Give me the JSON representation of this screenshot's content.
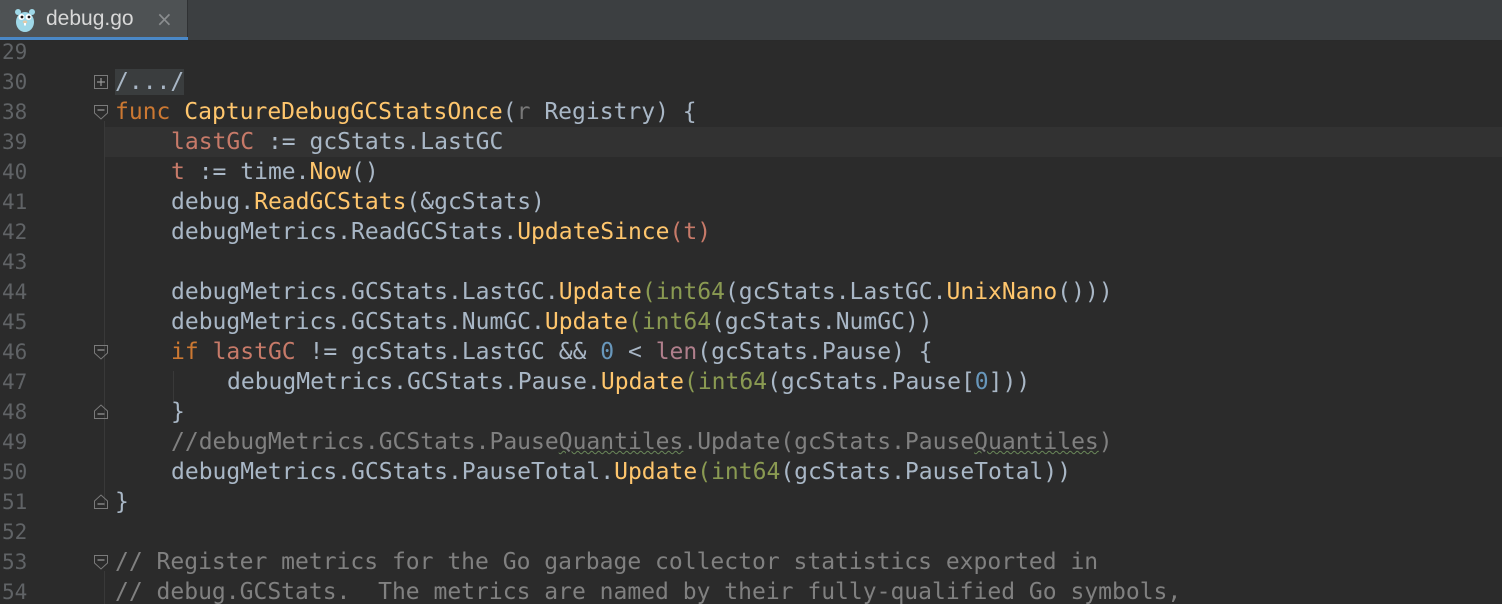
{
  "tab": {
    "filename": "debug.go",
    "close": "×"
  },
  "icons": {
    "file_icon": "gopher-icon",
    "close_icon": "close-icon",
    "fold_expand_icon": "fold-expand-icon",
    "fold_collapse_icon": "fold-collapse-icon"
  },
  "colors": {
    "background": "#2b2b2b",
    "keyword": "#cc7832",
    "function": "#ffc66d",
    "local_var": "#c77a69",
    "number": "#6897bb",
    "type": "#8a9a52",
    "comment": "#808080",
    "text": "#a9b7c6",
    "tab_underline": "#4a88c7"
  },
  "lines": [
    {
      "num": "29"
    },
    {
      "num": "30"
    },
    {
      "num": "38"
    },
    {
      "num": "39"
    },
    {
      "num": "40"
    },
    {
      "num": "41"
    },
    {
      "num": "42"
    },
    {
      "num": "43"
    },
    {
      "num": "44"
    },
    {
      "num": "45"
    },
    {
      "num": "46"
    },
    {
      "num": "47"
    },
    {
      "num": "48"
    },
    {
      "num": "49"
    },
    {
      "num": "50"
    },
    {
      "num": "51"
    },
    {
      "num": "52"
    },
    {
      "num": "53"
    },
    {
      "num": "54"
    }
  ],
  "code": {
    "l30_fold": "/.../",
    "l38_func": "func",
    "l38_name": "CaptureDebugGCStatsOnce",
    "l38_open": "(",
    "l38_param": "r",
    "l38_rest": " Registry) {",
    "l39_var": "lastGC",
    "l39_rest": " := gcStats.LastGC",
    "l40_var": "t",
    "l40_mid": " := time.",
    "l40_fn": "Now",
    "l40_rest": "()",
    "l41_pre": "debug.",
    "l41_fn": "ReadGCStats",
    "l41_rest": "(&gcStats)",
    "l42_pre": "debugMetrics.ReadGCStats.",
    "l42_fn": "UpdateSince",
    "l42_open": "(",
    "l42_var": "t",
    "l42_close": ")",
    "l44_pre": "debugMetrics.GCStats.LastGC.",
    "l44_fn": "Update",
    "l44_open": "(",
    "l44_typ": "int64",
    "l44_mid": "(gcStats.LastGC.",
    "l44_fn2": "UnixNano",
    "l44_rest": "()))",
    "l45_pre": "debugMetrics.GCStats.NumGC.",
    "l45_fn": "Update",
    "l45_open": "(",
    "l45_typ": "int64",
    "l45_rest": "(gcStats.NumGC))",
    "l46_kw": "if",
    "l46_var": "lastGC",
    "l46_mid": " != gcStats.LastGC && ",
    "l46_num": "0",
    "l46_mid2": " < ",
    "l46_bi": "len",
    "l46_rest": "(gcStats.Pause) {",
    "l47_pre": "debugMetrics.GCStats.Pause.",
    "l47_fn": "Update",
    "l47_open": "(",
    "l47_typ": "int64",
    "l47_mid": "(gcStats.Pause[",
    "l47_num": "0",
    "l47_rest": "]))",
    "l48_close": "}",
    "l49_c1": "//debugMetrics.GCStats.Pause",
    "l49_c2": "Quantiles",
    "l49_c3": ".Update(gcStats.Pause",
    "l49_c4": "Quantiles",
    "l49_c5": ")",
    "l50_pre": "debugMetrics.GCStats.PauseTotal.",
    "l50_fn": "Update",
    "l50_open": "(",
    "l50_typ": "int64",
    "l50_rest": "(gcStats.PauseTotal))",
    "l51_close": "}",
    "l53_comment": "// Register metrics for the Go garbage collector statistics exported in",
    "l54_comment": "// debug.GCStats.  The metrics are named by their fully-qualified Go symbols,"
  }
}
